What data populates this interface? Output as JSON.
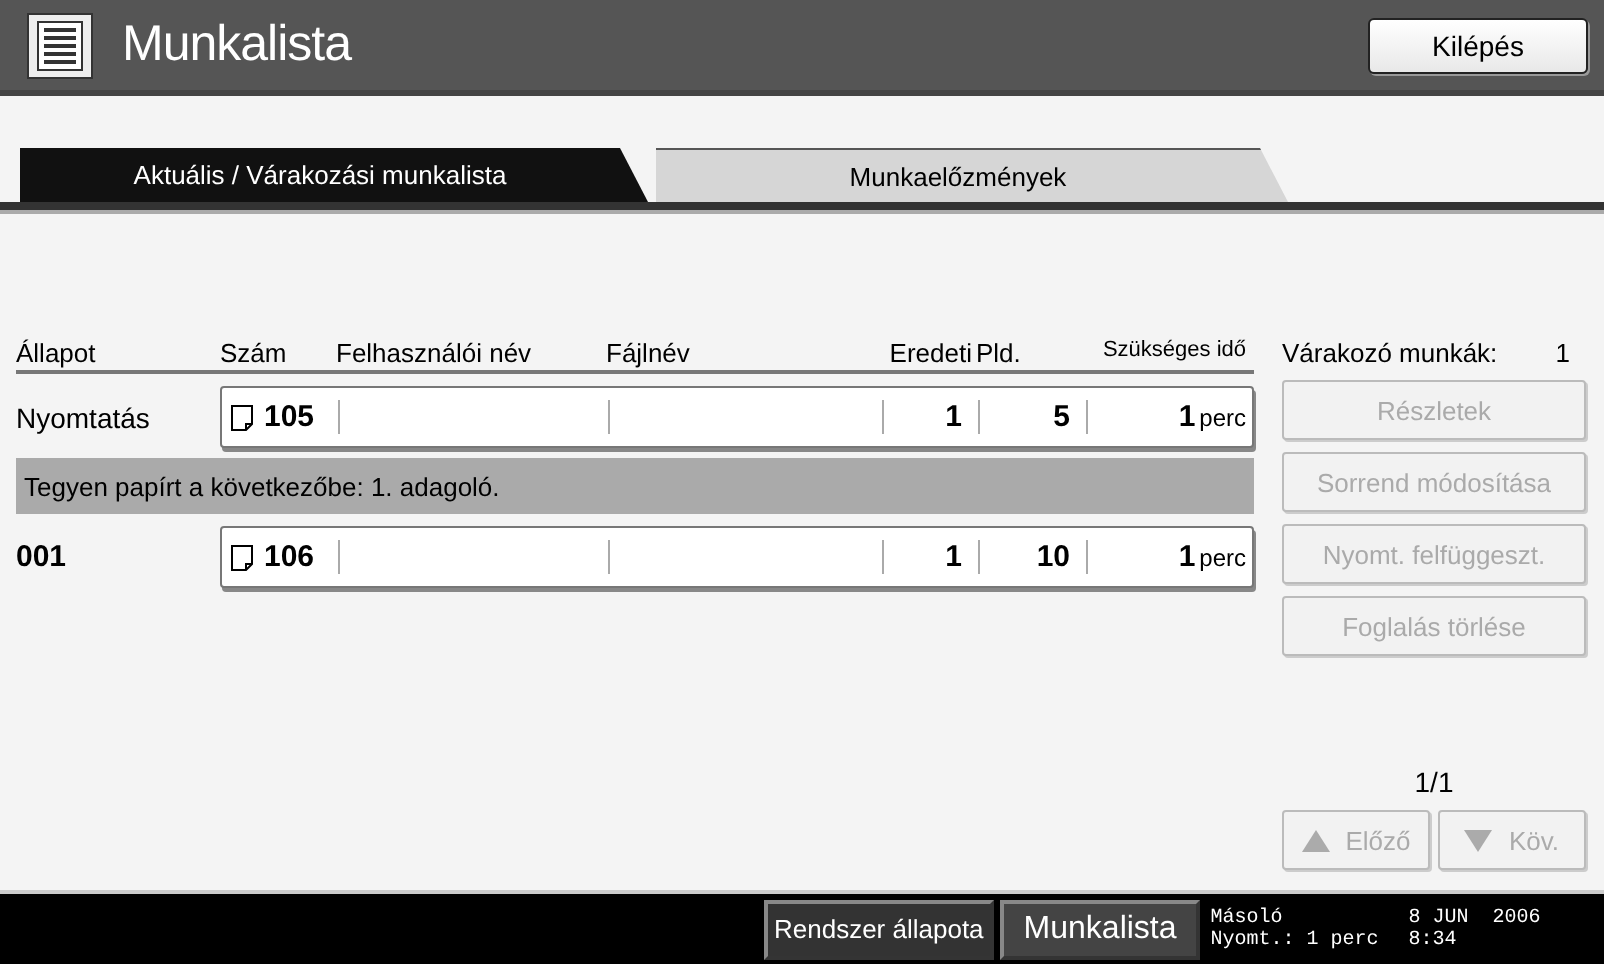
{
  "header": {
    "title": "Munkalista",
    "exit_button": "Kilépés"
  },
  "tabs": [
    {
      "label": "Aktuális / Várakozási munkalista",
      "selected": true
    },
    {
      "label": "Munkaelőzmények",
      "selected": false
    }
  ],
  "table": {
    "columns": [
      "Állapot",
      "Szám",
      "Felhasználói név",
      "Fájlnév",
      "Eredeti",
      "Pld.",
      "Szükséges idő"
    ],
    "rows": [
      {
        "kind": "job",
        "status": "Nyomtatás",
        "emphasized": false,
        "number": "105",
        "originals": "1",
        "copies": "5",
        "time": "1",
        "time_unit": "perc"
      },
      {
        "kind": "message",
        "text": "Tegyen papírt a következőbe: 1. adagoló."
      },
      {
        "kind": "job",
        "status": "001",
        "emphasized": true,
        "number": "106",
        "originals": "1",
        "copies": "10",
        "time": "1",
        "time_unit": "perc"
      }
    ]
  },
  "side": {
    "waiting_label": "Várakozó munkák:",
    "waiting_count": "1",
    "buttons": [
      {
        "label": "Részletek",
        "disabled": true
      },
      {
        "label": "Sorrend módosítása",
        "disabled": true
      },
      {
        "label": "Nyomt. felfüggeszt.",
        "disabled": true
      },
      {
        "label": "Foglalás törlése",
        "disabled": true
      }
    ],
    "page": "1/1",
    "nav": [
      {
        "kind": "up",
        "label": "Előző",
        "disabled": true
      },
      {
        "kind": "down",
        "label": "Köv.",
        "disabled": true
      }
    ]
  },
  "footer": {
    "buttons": [
      {
        "label": "Rendszer állapota",
        "selected": false
      },
      {
        "label": "Munkalista",
        "selected": true
      }
    ],
    "mode": "Másoló",
    "print_time": "Nyomt.: 1 perc",
    "date": "8 JUN  2006",
    "time": "8:34"
  }
}
